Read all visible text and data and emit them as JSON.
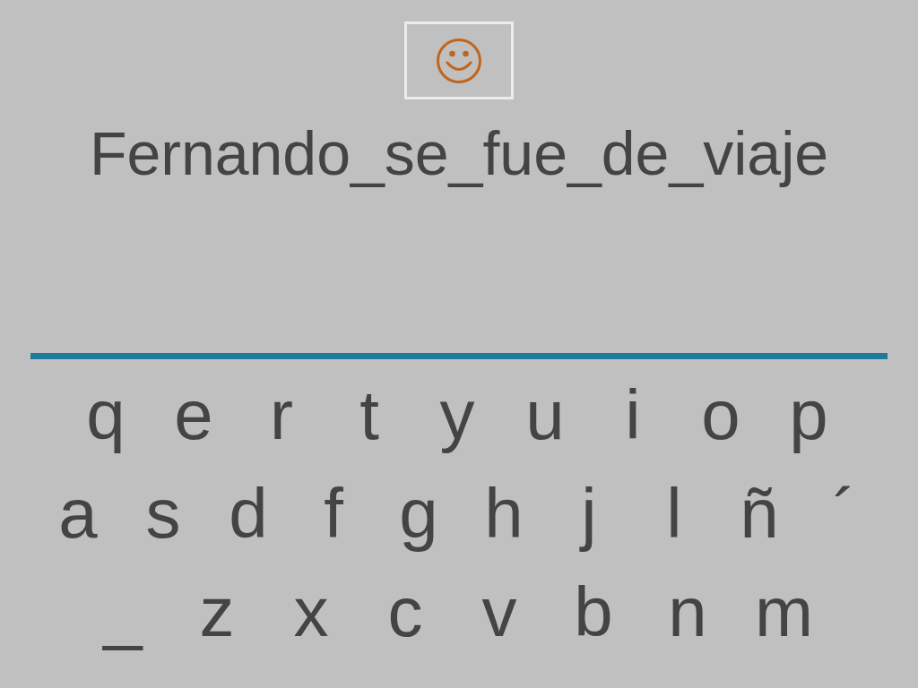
{
  "phrase": "Fernando_se_fue_de_viaje",
  "keyboard": {
    "rows": [
      {
        "keys": [
          "q",
          "e",
          "r",
          "t",
          "y",
          "u",
          "i",
          "o",
          "p"
        ]
      },
      {
        "keys": [
          "a",
          "s",
          "d",
          "f",
          "g",
          "h",
          "j",
          "l",
          "ñ",
          "´"
        ]
      },
      {
        "keys": [
          "_",
          "z",
          "x",
          "c",
          "v",
          "b",
          "n",
          "m"
        ]
      }
    ]
  }
}
